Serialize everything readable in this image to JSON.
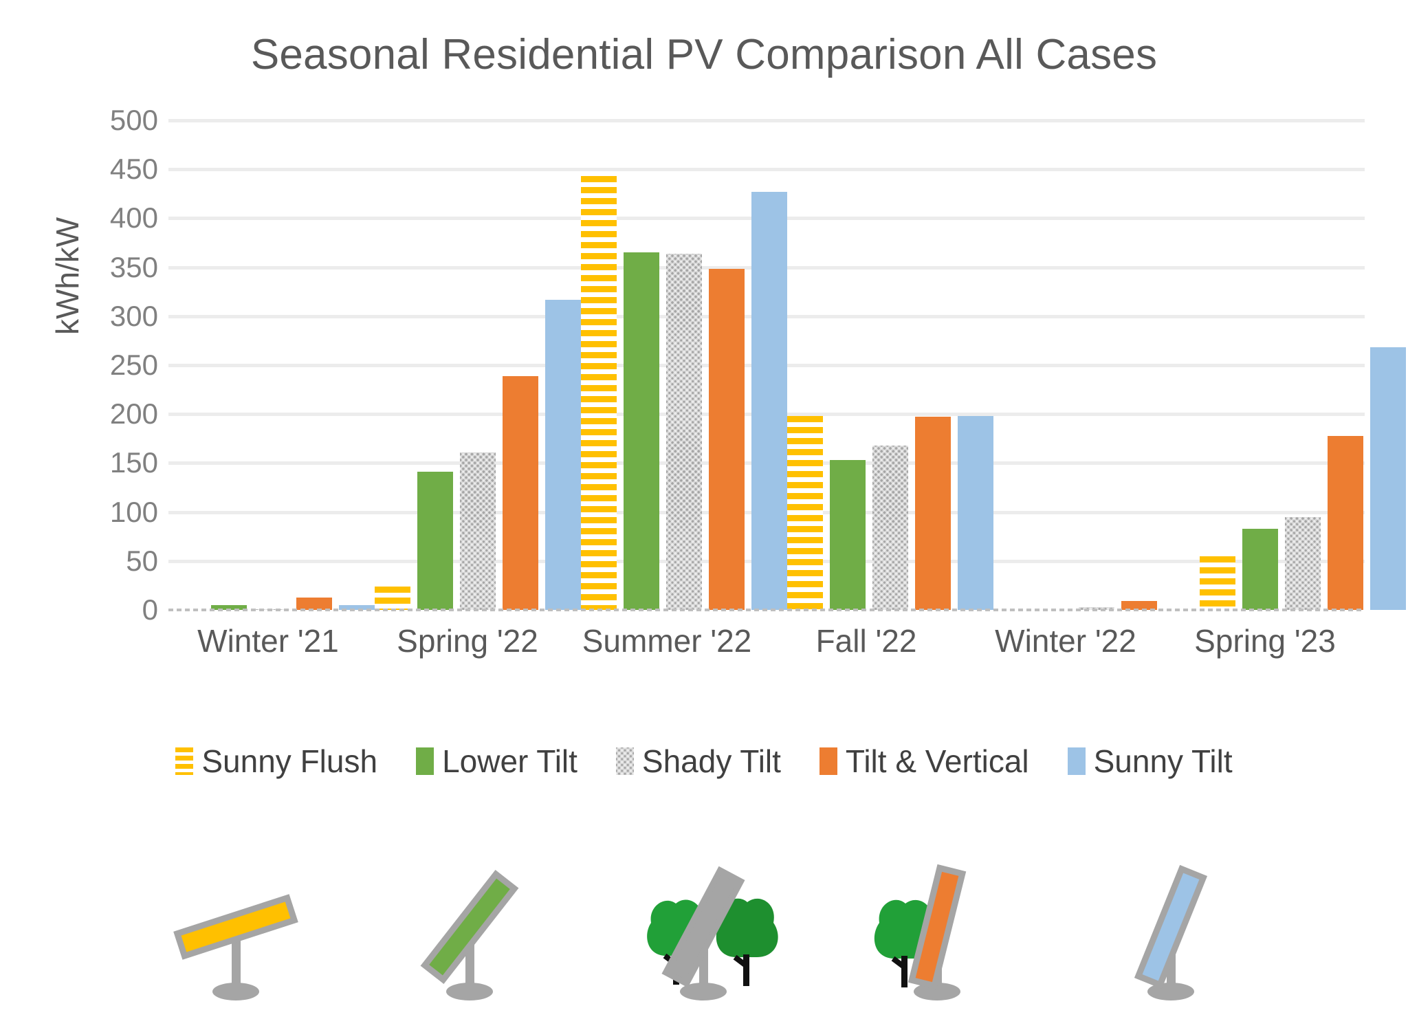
{
  "chart_data": {
    "type": "bar",
    "title": "Seasonal Residential PV Comparison All Cases",
    "xlabel": "",
    "ylabel": "kWh/kW",
    "ylim": [
      0,
      500
    ],
    "ytick_step": 50,
    "yticks": [
      "500",
      "450",
      "400",
      "350",
      "300",
      "250",
      "200",
      "150",
      "100",
      "50",
      "0"
    ],
    "grid": true,
    "legend_position": "bottom",
    "categories": [
      "Winter '21",
      "Spring '22",
      "Summer '22",
      "Fall '22",
      "Winter '22",
      "Spring '23"
    ],
    "series": [
      {
        "name": "Sunny Flush",
        "color": "#ffc000",
        "pattern": "horizontal-stripes",
        "values": [
          0,
          24,
          443,
          198,
          0,
          55
        ]
      },
      {
        "name": "Lower Tilt",
        "color": "#70ad47",
        "pattern": "solid",
        "values": [
          5,
          141,
          365,
          153,
          0,
          83
        ]
      },
      {
        "name": "Shady Tilt",
        "color": "#a5a5a5",
        "pattern": "checker",
        "values": [
          1,
          161,
          364,
          168,
          3,
          95
        ]
      },
      {
        "name": "Tilt & Vertical",
        "color": "#ed7d31",
        "pattern": "solid",
        "values": [
          13,
          239,
          348,
          197,
          9,
          178
        ]
      },
      {
        "name": "Sunny Tilt",
        "color": "#9dc3e6",
        "pattern": "solid",
        "values": [
          5,
          317,
          427,
          198,
          0,
          268
        ]
      }
    ]
  },
  "illustrations": [
    {
      "name": "sunny-flush-panel",
      "panel_color": "#ffc000",
      "has_trees": false
    },
    {
      "name": "lower-tilt-panel",
      "panel_color": "#70ad47",
      "has_trees": false
    },
    {
      "name": "shady-tilt-panel",
      "panel_color": "#a5a5a5",
      "has_trees": true
    },
    {
      "name": "tilt-and-vertical-panel",
      "panel_color": "#ed7d31",
      "has_trees": true
    },
    {
      "name": "sunny-tilt-panel",
      "panel_color": "#9dc3e6",
      "has_trees": false
    }
  ]
}
